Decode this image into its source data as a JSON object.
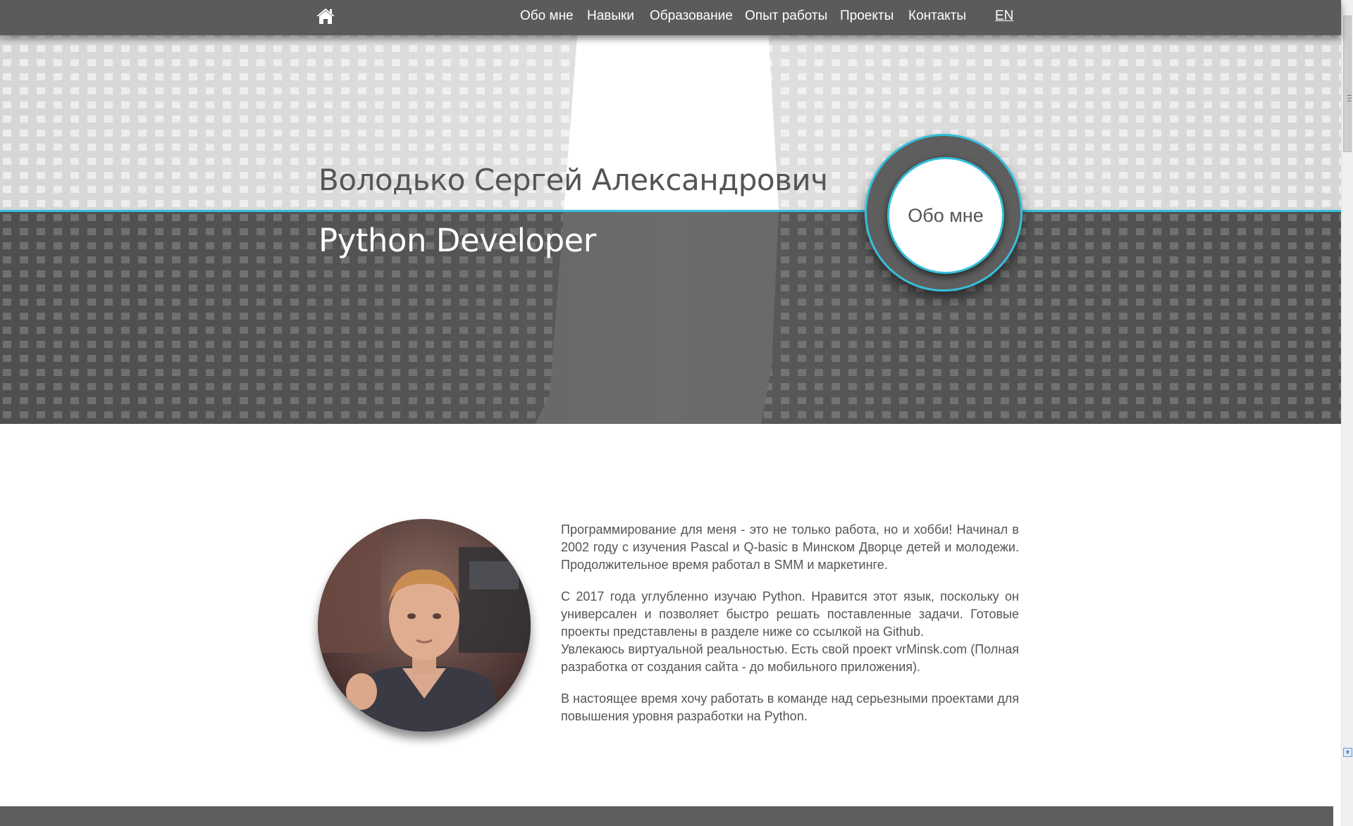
{
  "nav": {
    "home_icon": "home-icon",
    "items": [
      {
        "label": "Обо мне"
      },
      {
        "label": "Навыки"
      },
      {
        "label": "Образование"
      },
      {
        "label": "Опыт работы"
      },
      {
        "label": "Проекты"
      },
      {
        "label": "Контакты"
      }
    ],
    "lang": "EN"
  },
  "hero": {
    "name": "Володько Сергей Александрович",
    "role": "Python Developer",
    "badge_label": "Обо мне"
  },
  "about": {
    "photo_icon": "profile-photo",
    "paragraphs": [
      "Программирование для меня - это не только работа, но и хобби! Начинал в 2002 году с изучения Pascal и Q-basic в Минском Дворце детей и молодежи. Продолжительное время работал в SMM и маркетинге.",
      "С 2017 года углубленно изучаю Python. Нравится этот язык, поскольку он универсален и позволяет быстро решать поставленные задачи. Готовые проекты представлены в разделе ниже со ссылкой на Github.",
      "Увлекаюсь виртуальной реальностью. Есть свой проект vrMinsk.com (Полная разработка от создания сайта - до мобильного приложения).",
      "В настоящее время хочу работать в команде над серьезными проектами для повышения уровня разработки на Python."
    ]
  },
  "colors": {
    "nav_bg": "#5b5b5b",
    "accent": "#35c0dc",
    "text": "#555555",
    "hero_dark": "#5e5e5e"
  }
}
